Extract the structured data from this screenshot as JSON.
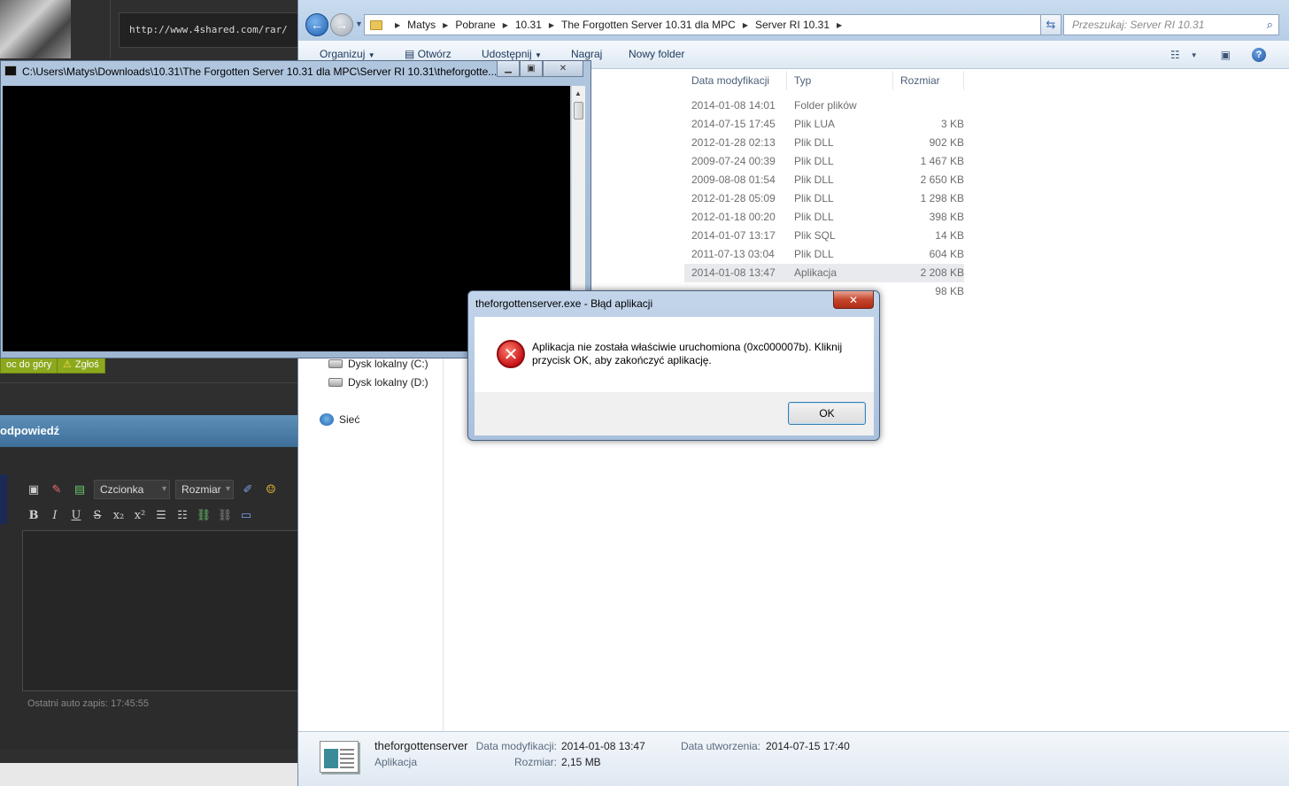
{
  "forum": {
    "code_url": "http://www.4shared.com/rar/",
    "btn_top": "oc do góry",
    "btn_report": "Zgłoś",
    "reply_title": "odpowiedź",
    "font_select": "Czcionka",
    "size_select": "Rozmiar",
    "autosave": "Ostatni auto zapis: 17:45:55"
  },
  "explorer": {
    "breadcrumb": [
      "Matys",
      "Pobrane",
      "10.31",
      "The Forgotten Server 10.31 dla MPC",
      "Server RI 10.31"
    ],
    "search_placeholder": "Przeszukaj: Server RI 10.31",
    "commands": {
      "organize": "Organizuj",
      "open": "Otwórz",
      "share": "Udostępnij",
      "burn": "Nagraj",
      "new_folder": "Nowy folder"
    },
    "nav": {
      "drive_c": "Dysk lokalny (C:)",
      "drive_d": "Dysk lokalny (D:)",
      "network": "Sieć"
    },
    "columns": {
      "date": "Data modyfikacji",
      "type": "Typ",
      "size": "Rozmiar"
    },
    "files": [
      {
        "date": "2014-01-08 14:01",
        "type": "Folder plików",
        "size": ""
      },
      {
        "date": "2014-07-15 17:45",
        "type": "Plik LUA",
        "size": "3 KB"
      },
      {
        "date": "2012-01-28 02:13",
        "type": "Plik DLL",
        "size": "902 KB"
      },
      {
        "date": "2009-07-24 00:39",
        "type": "Plik DLL",
        "size": "1 467 KB"
      },
      {
        "date": "2009-08-08 01:54",
        "type": "Plik DLL",
        "size": "2 650 KB"
      },
      {
        "date": "2012-01-28 05:09",
        "type": "Plik DLL",
        "size": "1 298 KB"
      },
      {
        "date": "2012-01-18 00:20",
        "type": "Plik DLL",
        "size": "398 KB"
      },
      {
        "date": "2014-01-07 13:17",
        "type": "Plik SQL",
        "size": "14 KB"
      },
      {
        "date": "2011-07-13 03:04",
        "type": "Plik DLL",
        "size": "604 KB"
      },
      {
        "date": "2014-01-08 13:47",
        "type": "Aplikacja",
        "size": "2 208 KB"
      },
      {
        "date": "",
        "type": "",
        "size": "98 KB"
      }
    ],
    "details": {
      "name": "theforgottenserver",
      "kind": "Aplikacja",
      "modified_label": "Data modyfikacji:",
      "modified_value": "2014-01-08 13:47",
      "size_label": "Rozmiar:",
      "size_value": "2,15 MB",
      "created_label": "Data utworzenia:",
      "created_value": "2014-07-15 17:40"
    }
  },
  "console": {
    "title": "C:\\Users\\Matys\\Downloads\\10.31\\The Forgotten Server 10.31 dla MPC\\Server RI 10.31\\theforgotte..."
  },
  "dialog": {
    "title": "theforgottenserver.exe - Błąd aplikacji",
    "message": "Aplikacja nie została właściwie uruchomiona (0xc000007b). Kliknij przycisk OK, aby zakończyć aplikację.",
    "ok": "OK"
  }
}
